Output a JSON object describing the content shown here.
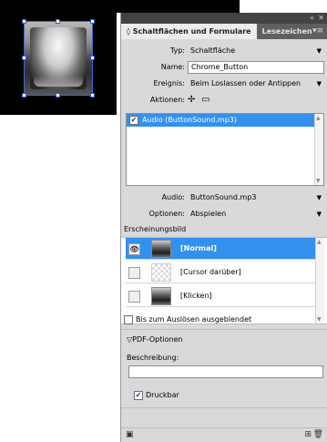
{
  "panel": {
    "tabs": [
      {
        "label": "◊ Schaltflächen und Formulare"
      },
      {
        "label": "Lesezeichen"
      }
    ],
    "controls": {
      "collapse": "«",
      "close": "✕",
      "menu": "▾≡"
    }
  },
  "form": {
    "typ_label": "Typ:",
    "typ_value": "Schaltfläche",
    "name_label": "Name:",
    "name_value": "Chrome_Button",
    "ereignis_label": "Ereignis:",
    "ereignis_value": "Beim Loslassen oder Antippen",
    "aktionen_label": "Aktionen:"
  },
  "actions_list": {
    "items": [
      {
        "label": "Audio (ButtonSound.mp3)",
        "checked": true
      }
    ]
  },
  "audio": {
    "audio_label": "Audio:",
    "audio_value": "ButtonSound.mp3",
    "optionen_label": "Optionen:",
    "optionen_value": "Abspielen"
  },
  "appearance": {
    "section_label": "Erscheinungsbild",
    "states": [
      {
        "label": "[Normal]",
        "selected": true
      },
      {
        "label": "[Cursor darüber]",
        "selected": false
      },
      {
        "label": "[Klicken]",
        "selected": false
      }
    ],
    "hidden_until_trigger_label": "Bis zum Auslösen ausgeblendet"
  },
  "pdf": {
    "section_label": "PDF-Optionen",
    "beschreibung_label": "Beschreibung:",
    "beschreibung_value": "",
    "druckbar_label": "Druckbar",
    "druckbar_checked": true
  },
  "colors": {
    "selection_blue": "#3391ee",
    "panel_bg": "#d9d9d9",
    "tabbar_bg": "#5f5f5f"
  }
}
